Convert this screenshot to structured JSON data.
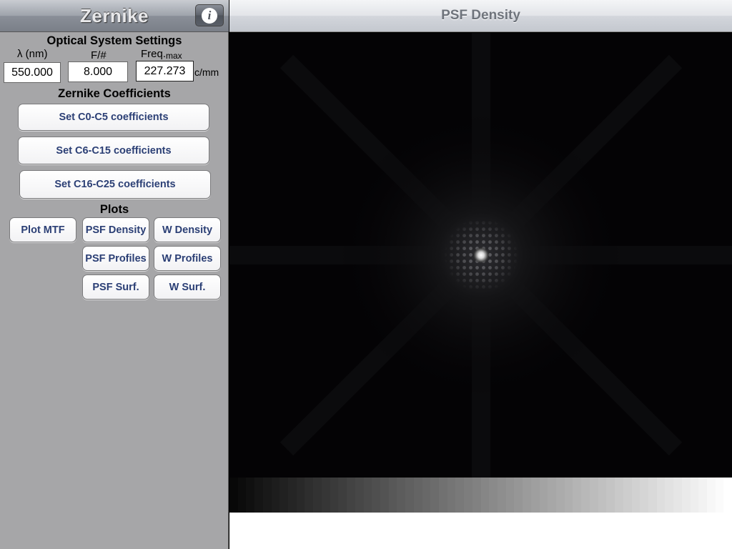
{
  "left_panel": {
    "app_title": "Zernike",
    "info_icon": "info-icon",
    "optical_heading": "Optical System Settings",
    "lambda_label": "λ (nm)",
    "f_label": "F/#",
    "freq_label": "Freq.",
    "freq_sub": "max",
    "lambda_value": "550.000",
    "f_value": "8.000",
    "freq_value": "227.273",
    "freq_unit": "c/mm",
    "zernike_heading": "Zernike Coefficients",
    "btn_c0_c5": "Set C0-C5 coefficients",
    "btn_c6_c15": "Set C6-C15 coefficients",
    "btn_c16_c25": "Set C16-C25 coefficients",
    "plots_heading": "Plots",
    "plot_mtf": "Plot MTF",
    "psf_density": "PSF Density",
    "w_density": "W Density",
    "psf_profiles": "PSF Profiles",
    "w_profiles": "W Profiles",
    "psf_surf": "PSF Surf.",
    "w_surf": "W Surf."
  },
  "right_panel": {
    "title": "PSF Density",
    "image": "psf-density-image",
    "colorbar": "grayscale-colorbar"
  }
}
